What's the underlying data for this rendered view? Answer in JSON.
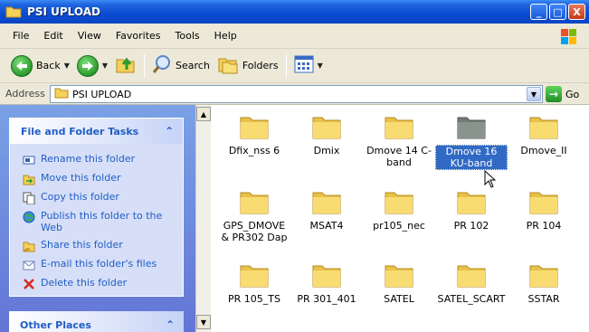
{
  "window": {
    "title": "PSI UPLOAD",
    "minimize": "_",
    "maximize": "□",
    "close": "X"
  },
  "menu": [
    "File",
    "Edit",
    "View",
    "Favorites",
    "Tools",
    "Help"
  ],
  "toolbar": {
    "back_label": "Back",
    "search_label": "Search",
    "folders_label": "Folders"
  },
  "address": {
    "label": "Address",
    "value": "PSI UPLOAD",
    "go_label": "Go"
  },
  "tasks": {
    "header": "File and Folder Tasks",
    "items": [
      "Rename this folder",
      "Move this folder",
      "Copy this folder",
      "Publish this folder to the Web",
      "Share this folder",
      "E-mail this folder's files",
      "Delete this folder"
    ]
  },
  "other_places": {
    "header": "Other Places"
  },
  "folders": [
    "Dfix_nss 6",
    "Dmix",
    "Dmove 14 C-band",
    "Dmove 16 KU-band",
    "Dmove_II",
    "GPS_DMOVE & PR302 Dap",
    "MSAT4",
    "pr105_nec",
    "PR 102",
    "PR 104",
    "PR 105_TS",
    "PR 301_401",
    "SATEL",
    "SATEL_SCART",
    "SSTAR"
  ],
  "selected_folder": "Dmove 16 KU-band",
  "colors": {
    "titlebar": "#0a4cd1",
    "task_text": "#215dc6",
    "folder": "#f6d15a",
    "selection": "#316ac5"
  }
}
